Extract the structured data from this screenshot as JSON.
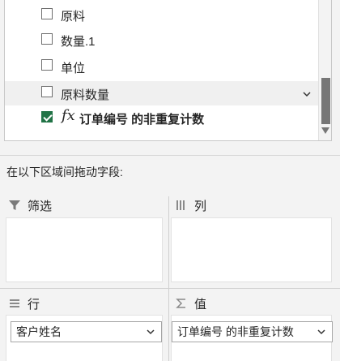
{
  "field_list": {
    "items": [
      {
        "label": "原料",
        "checked": false
      },
      {
        "label": "数量.1",
        "checked": false
      },
      {
        "label": "单位",
        "checked": false
      },
      {
        "label": "原料数量",
        "checked": false
      },
      {
        "fx": "fx",
        "label": "订单编号 的非重复计数",
        "checked": true
      }
    ]
  },
  "instruction": "在以下区域间拖动字段:",
  "areas": {
    "filters": {
      "title": "筛选"
    },
    "columns": {
      "title": "列"
    },
    "rows": {
      "title": "行",
      "fields": [
        "客户姓名"
      ]
    },
    "values": {
      "title": "值",
      "fields": [
        "订单编号 的非重复计数"
      ]
    }
  },
  "colors": {
    "checkbox_checked": "#217346",
    "scroll_thumb": "#767676"
  }
}
